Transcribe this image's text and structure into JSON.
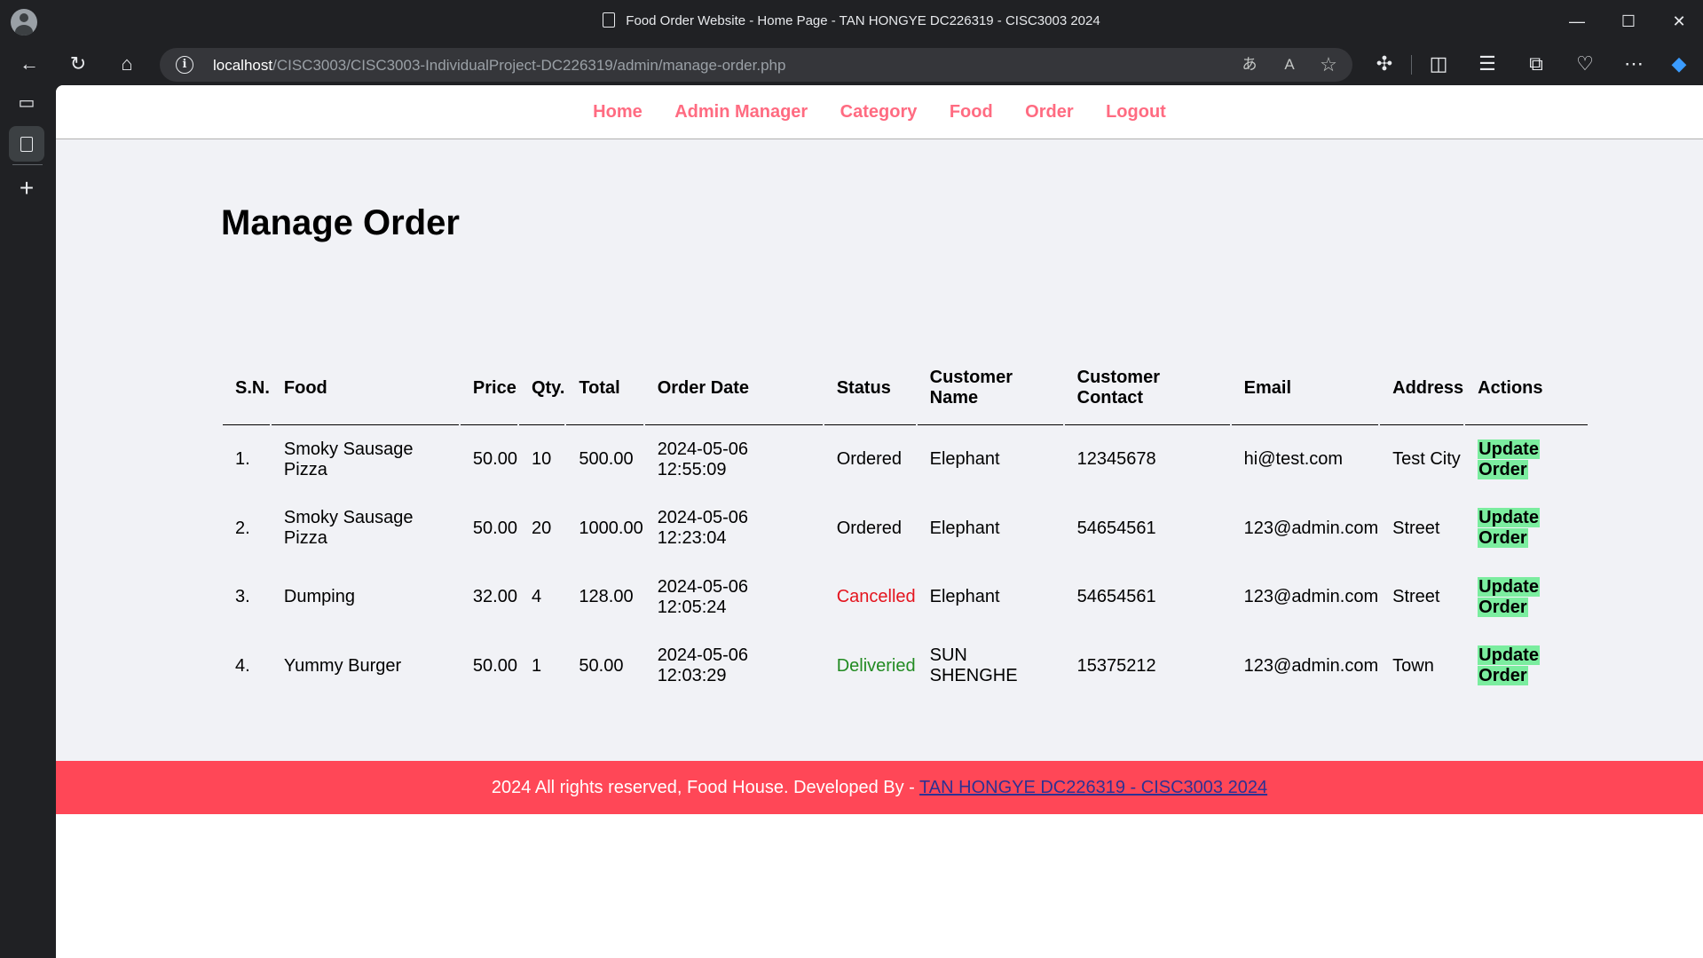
{
  "window": {
    "title": "Food Order Website - Home Page - TAN HONGYE DC226319 - CISC3003 2024"
  },
  "address": {
    "host": "localhost",
    "path": "/CISC3003/CISC3003-IndividualProject-DC226319/admin/manage-order.php"
  },
  "icons": {
    "back": "←",
    "reload": "↻",
    "home": "⌂",
    "info": "i",
    "translate": "あ",
    "read_aloud": "A",
    "favorite": "☆",
    "extensions": "✣",
    "split": "◫",
    "favorites": "☰",
    "collections": "⧉",
    "health": "♡",
    "more": "⋯",
    "copilot": "◆",
    "minimize": "—",
    "maximize": "☐",
    "close": "✕",
    "tabs": "▭",
    "newtab": "+"
  },
  "nav": [
    "Home",
    "Admin Manager",
    "Category",
    "Food",
    "Order",
    "Logout"
  ],
  "page": {
    "title": "Manage Order"
  },
  "table": {
    "headers": {
      "sn": "S.N.",
      "food": "Food",
      "price": "Price",
      "qty": "Qty.",
      "total": "Total",
      "date": "Order Date",
      "status": "Status",
      "name": "Customer Name",
      "contact": "Customer Contact",
      "email": "Email",
      "address": "Address",
      "actions": "Actions"
    },
    "rows": [
      {
        "sn": "1.",
        "food": "Smoky Sausage Pizza",
        "price": "50.00",
        "qty": "10",
        "total": "500.00",
        "date": "2024-05-06 12:55:09",
        "status": "Ordered",
        "name": "Elephant",
        "contact": "12345678",
        "email": "hi@test.com",
        "address": "Test City",
        "action": "Update Order"
      },
      {
        "sn": "2.",
        "food": "Smoky Sausage Pizza",
        "price": "50.00",
        "qty": "20",
        "total": "1000.00",
        "date": "2024-05-06 12:23:04",
        "status": "Ordered",
        "name": "Elephant",
        "contact": "54654561",
        "email": "123@admin.com",
        "address": "Street",
        "action": "Update Order"
      },
      {
        "sn": "3.",
        "food": "Dumping",
        "price": "32.00",
        "qty": "4",
        "total": "128.00",
        "date": "2024-05-06 12:05:24",
        "status": "Cancelled",
        "name": "Elephant",
        "contact": "54654561",
        "email": "123@admin.com",
        "address": "Street",
        "action": "Update Order"
      },
      {
        "sn": "4.",
        "food": "Yummy Burger",
        "price": "50.00",
        "qty": "1",
        "total": "50.00",
        "date": "2024-05-06 12:03:29",
        "status": "Deliveried",
        "name": "SUN SHENGHE",
        "contact": "15375212",
        "email": "123@admin.com",
        "address": "Town",
        "action": "Update Order"
      }
    ]
  },
  "footer": {
    "text": "2024 All rights reserved, Food House. Developed By - ",
    "link": "TAN HONGYE DC226319 - CISC3003 2024"
  },
  "colors": {
    "nav_link": "#ff6b81",
    "footer_bg": "#ff4757",
    "update_btn": "#7bed9f",
    "cancelled": "#e4141e",
    "delivered": "#228b22"
  }
}
